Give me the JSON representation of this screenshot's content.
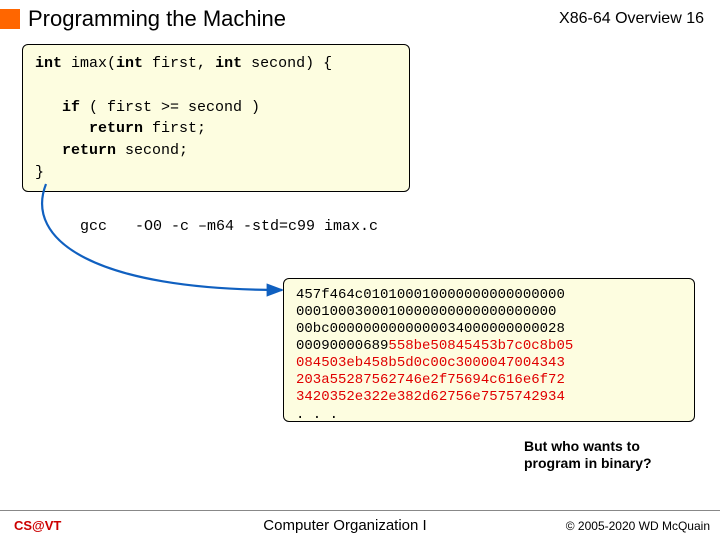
{
  "header": {
    "title": "Programming the Machine",
    "overview": "X86-64 Overview 16"
  },
  "code": {
    "sig": "int imax(int first, int second) {",
    "l1": "   if ( first >= second )",
    "l2": "      return first;",
    "l3": "   return second;",
    "l4": "}",
    "kw_int": "int",
    "kw_if": "if",
    "kw_ret": "return"
  },
  "gcc": {
    "label": "gcc",
    "cmd": "-O0 -c –m64 -std=c99 imax.c"
  },
  "hex": {
    "l1a": "457f464c010100010000000000000000",
    "l2a": "0001000300010000000000000000000",
    "l3a": "00bc0000000000000034000000000028",
    "l4a": "00090000689",
    "l4b": "558be50845453b7c0c8b05",
    "l5a": "084503eb458b5d0c00c3000047004343",
    "l6a": "203a55287562746e2f75694c616e6f72",
    "l7a": "3420352e322e382d62756e7575742934",
    "l8a": ". . ."
  },
  "callout": "But who wants to program in binary?",
  "footer": {
    "left": "CS@VT",
    "center": "Computer Organization I",
    "right": "© 2005-2020 WD McQuain"
  }
}
